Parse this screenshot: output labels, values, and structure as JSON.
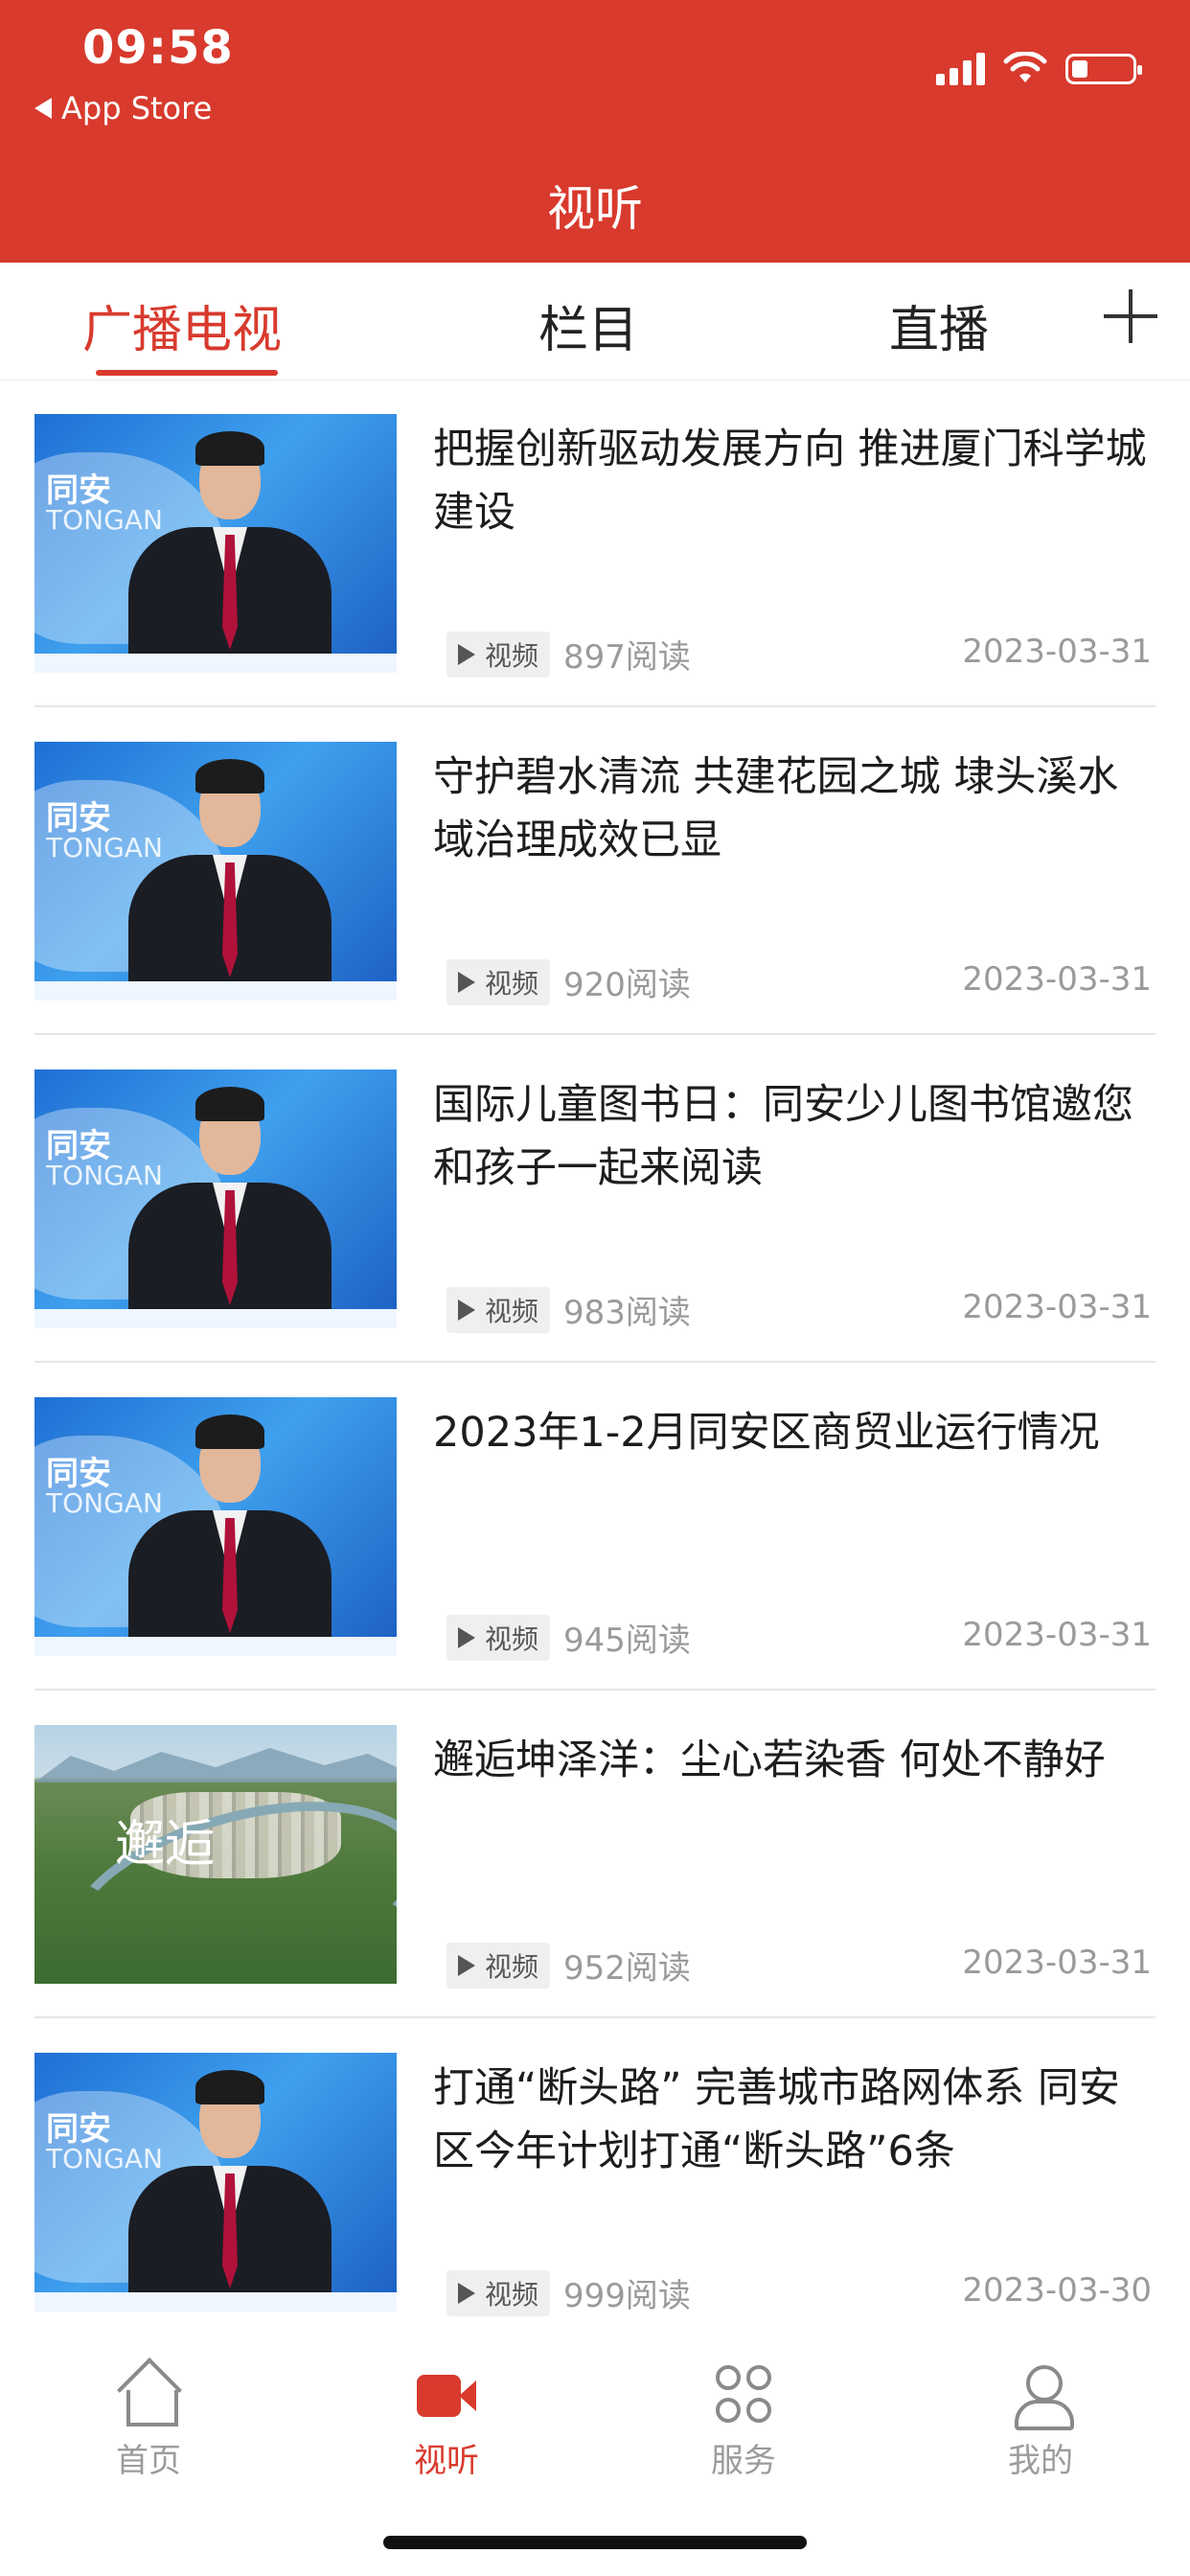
{
  "status_bar": {
    "time": "09:58",
    "back_app": "App Store"
  },
  "header": {
    "title": "视听"
  },
  "tabs": [
    {
      "label": "广播电视",
      "active": true
    },
    {
      "label": "栏目",
      "active": false
    },
    {
      "label": "直播",
      "active": false
    }
  ],
  "tag_label": "视频",
  "articles": [
    {
      "title": "把握创新驱动发展方向 推进厦门科学城建设",
      "reads": "897阅读",
      "date": "2023-03-31",
      "thumb": "news-anchor",
      "thumb_logo_cn": "同安",
      "thumb_logo_en": "TONGAN"
    },
    {
      "title": "守护碧水清流 共建花园之城 埭头溪水域治理成效已显",
      "reads": "920阅读",
      "date": "2023-03-31",
      "thumb": "news-anchor",
      "thumb_logo_cn": "同安",
      "thumb_logo_en": "TONGAN"
    },
    {
      "title": "国际儿童图书日：同安少儿图书馆邀您和孩子一起来阅读",
      "reads": "983阅读",
      "date": "2023-03-31",
      "thumb": "news-anchor",
      "thumb_logo_cn": "同安",
      "thumb_logo_en": "TONGAN"
    },
    {
      "title": "2023年1-2月同安区商贸业运行情况",
      "reads": "945阅读",
      "date": "2023-03-31",
      "thumb": "news-anchor",
      "thumb_logo_cn": "同安",
      "thumb_logo_en": "TONGAN"
    },
    {
      "title": "邂逅坤泽洋：尘心若染香 何处不静好",
      "reads": "952阅读",
      "date": "2023-03-31",
      "thumb": "landscape",
      "thumb_calligraphy": "邂逅"
    },
    {
      "title": "打通“断头路” 完善城市路网体系 同安区今年计划打通“断头路”6条",
      "reads": "999阅读",
      "date": "2023-03-30",
      "thumb": "news-anchor",
      "thumb_logo_cn": "同安",
      "thumb_logo_en": "TONGAN"
    }
  ],
  "bottom_nav": [
    {
      "label": "首页",
      "icon": "home-icon",
      "active": false
    },
    {
      "label": "视听",
      "icon": "video-camera-icon",
      "active": true
    },
    {
      "label": "服务",
      "icon": "grid-icon",
      "active": false
    },
    {
      "label": "我的",
      "icon": "person-icon",
      "active": false
    }
  ],
  "colors": {
    "brand_red": "#D83A2D",
    "meta_gray": "#9a9a9a"
  }
}
